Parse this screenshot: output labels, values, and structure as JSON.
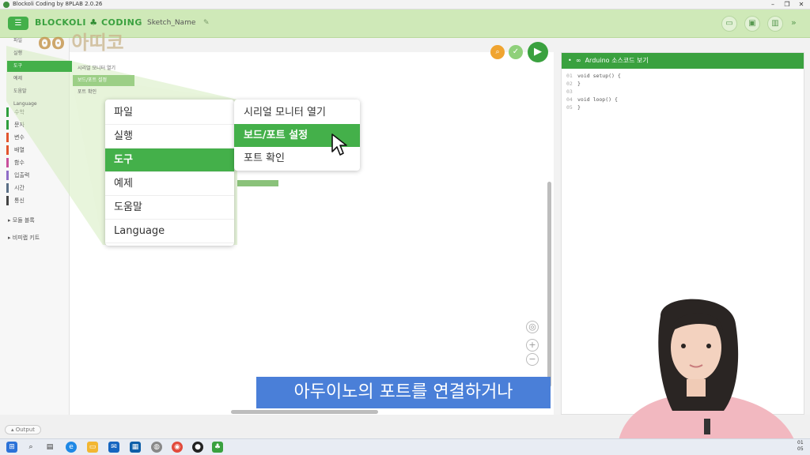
{
  "window": {
    "title": "Blockoli Coding by 8PLAB 2.0.26"
  },
  "header": {
    "brand": "BLOCKOLI",
    "brand2": "CODING",
    "sketch_name": "Sketch_Name"
  },
  "watermark": "아띠코",
  "sidebar": {
    "categories": [
      {
        "label": "파일",
        "color": "#3b7ddd"
      },
      {
        "label": "실행",
        "color": "#3b7ddd"
      },
      {
        "label": "도구",
        "color": "#3b7ddd"
      },
      {
        "label": "예제",
        "color": "#3b7ddd"
      },
      {
        "label": "도움말",
        "color": "#3b7ddd"
      },
      {
        "label": "Language",
        "color": "#3b7ddd"
      },
      {
        "label": "수학",
        "color": "#2e9e3c"
      },
      {
        "label": "문자",
        "color": "#2e9e3c"
      },
      {
        "label": "변수",
        "color": "#e2542d"
      },
      {
        "label": "배열",
        "color": "#e2542d"
      },
      {
        "label": "함수",
        "color": "#c94f9b"
      },
      {
        "label": "입출력",
        "color": "#8f6dc7"
      },
      {
        "label": "시간",
        "color": "#5a6f86"
      },
      {
        "label": "통신",
        "color": "#444444"
      }
    ],
    "modules": [
      "모듈 블록",
      "비피랩 키트"
    ]
  },
  "small_menu": {
    "items": [
      "파일",
      "실행",
      "도구",
      "예제",
      "도움말",
      "Language"
    ],
    "sub": [
      "시리얼 모니터 열기",
      "보드/포트 설정",
      "포트 확인"
    ]
  },
  "zoom_menu": {
    "items": [
      "파일",
      "실행",
      "도구",
      "예제",
      "도움말",
      "Language"
    ],
    "active_index": 2,
    "sub": [
      "시리얼 모니터 열기",
      "보드/포트 설정",
      "포트 확인"
    ],
    "sub_active_index": 1
  },
  "code_panel": {
    "title": "Arduino 소스코드 보기",
    "lines": [
      {
        "n": "01",
        "code": "void setup() {"
      },
      {
        "n": "02",
        "code": "}"
      },
      {
        "n": "03",
        "code": ""
      },
      {
        "n": "04",
        "code": "void loop() {"
      },
      {
        "n": "05",
        "code": "}"
      }
    ]
  },
  "caption": "아두이노의 포트를 연결하거나",
  "output_label": "Output",
  "clock": {
    "time": "01",
    "date": "05"
  },
  "colors": {
    "accent": "#44b04a",
    "header_bg": "#cfe9b8",
    "caption_bg": "#4a7fd8"
  }
}
